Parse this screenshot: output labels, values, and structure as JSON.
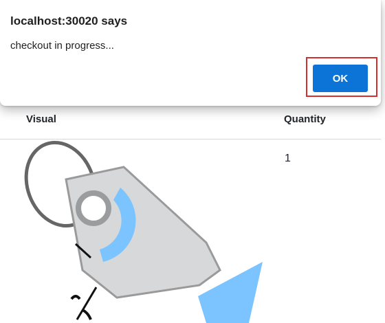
{
  "dialog": {
    "title": "localhost:30020 says",
    "message": "checkout in progress...",
    "ok_label": "OK"
  },
  "table": {
    "columns": [
      "Visual",
      "Quantity"
    ],
    "rows": [
      {
        "quantity": "1"
      }
    ]
  },
  "colors": {
    "ok_button": "#0b74d6",
    "highlight_box": "#d32f2f",
    "tag_accent": "#7cc4ff"
  },
  "icons": {
    "product": "price-tag-icon"
  }
}
